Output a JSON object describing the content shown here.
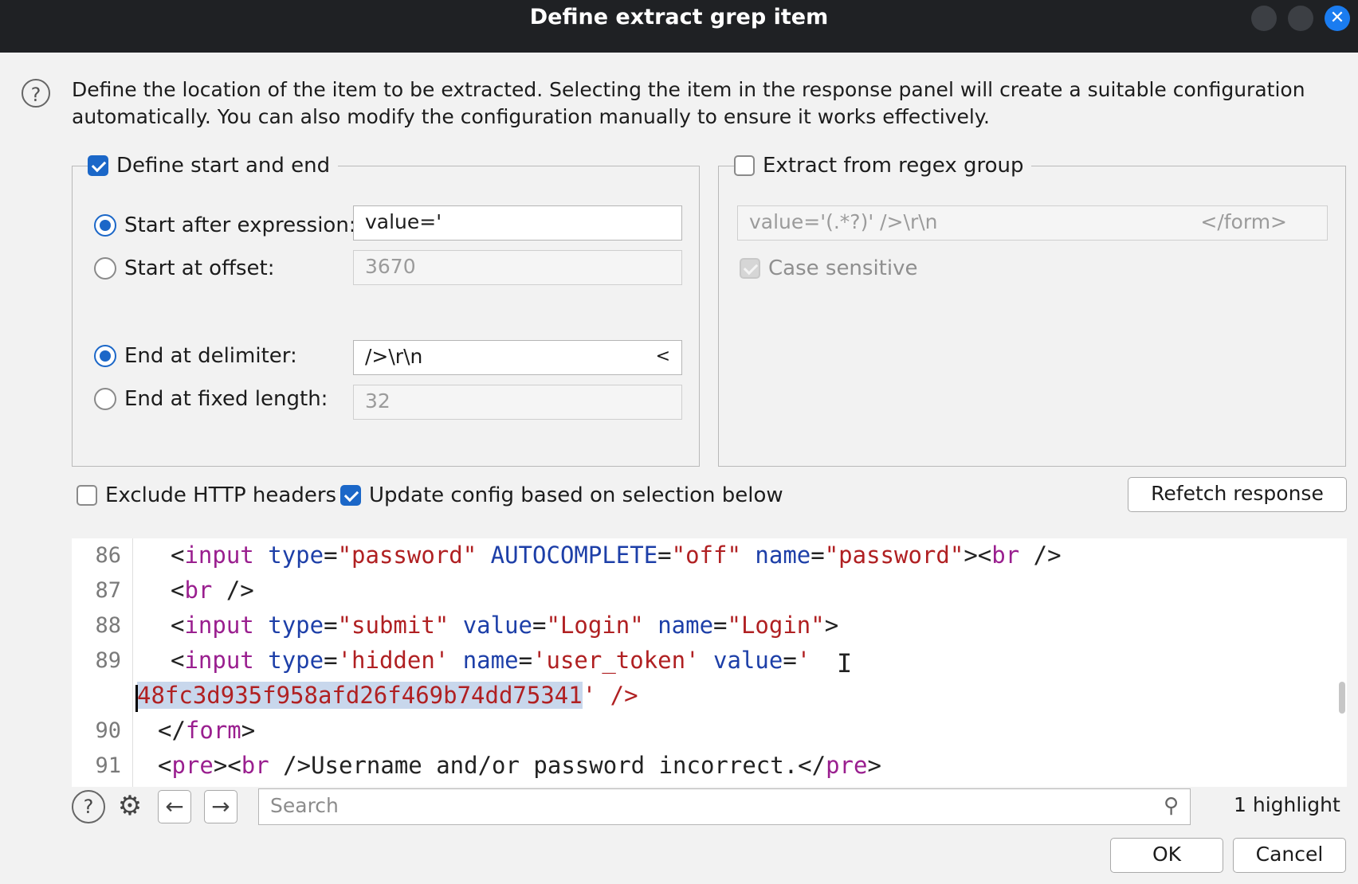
{
  "window": {
    "title": "Define extract grep item"
  },
  "intro": "Define the location of the item to be extracted. Selecting the item in the response panel will create a suitable configuration automatically. You can also modify the configuration manually to ensure it works effectively.",
  "left_group": {
    "legend": "Define start and end",
    "checked": true,
    "start_after_label": "Start after expression:",
    "start_after_value": "value='",
    "start_offset_label": "Start at offset:",
    "start_offset_value": "3670",
    "end_delim_label": "End at delimiter:",
    "end_delim_value": "/>\\r\\n",
    "end_delim_suffix": "<",
    "end_fixed_label": "End at fixed length:",
    "end_fixed_value": "32"
  },
  "right_group": {
    "legend": "Extract from regex group",
    "checked": false,
    "regex_value": "value='(.*?)' />\\r\\n",
    "regex_suffix": "</form>",
    "case_label": "Case sensitive"
  },
  "options": {
    "exclude_headers": "Exclude HTTP headers",
    "update_config": "Update config based on selection below",
    "refetch": "Refetch response"
  },
  "editor": {
    "line_numbers": [
      "86",
      "87",
      "88",
      "89",
      "90",
      "91"
    ],
    "l86": {
      "open": "<",
      "tag": "input",
      "a1": "type",
      "eq1": "=",
      "v1": "\"password\"",
      "a2": "AUTOCOMPLETE",
      "eq2": "=",
      "v2": "\"off\"",
      "a3": "name",
      "eq3": "=",
      "v3": "\"password\"",
      "close": "><",
      "tag2": "br",
      "end": " />"
    },
    "l87": {
      "open": "<",
      "tag": "br",
      "end": " />"
    },
    "l88": {
      "open": "<",
      "tag": "input",
      "a1": "type",
      "eq1": "=",
      "v1": "\"submit\"",
      "a2": "value",
      "eq2": "=",
      "v2": "\"Login\"",
      "a3": "name",
      "eq3": "=",
      "v3": "\"Login\"",
      "end": ">"
    },
    "l89": {
      "open": "<",
      "tag": "input",
      "a1": "type",
      "eq1": "=",
      "v1": "'hidden'",
      "a2": "name",
      "eq2": "=",
      "v2": "'user_token'",
      "a3": "value",
      "eq3": "=",
      "v3": "'"
    },
    "l89b": {
      "selected": "48fc3d935f958afd26f469b74dd75341",
      "rest": "' />"
    },
    "l90": {
      "open": "</",
      "tag": "form",
      "end": ">"
    },
    "l91": {
      "open": "<",
      "tag": "pre",
      "mid": "><",
      "tag2": "br",
      "text": " />Username and/or password incorrect.</",
      "tag3": "pre",
      "end": ">"
    }
  },
  "toolbar": {
    "search_placeholder": "Search",
    "highlight_count": "1 highlight"
  },
  "buttons": {
    "ok": "OK",
    "cancel": "Cancel"
  }
}
